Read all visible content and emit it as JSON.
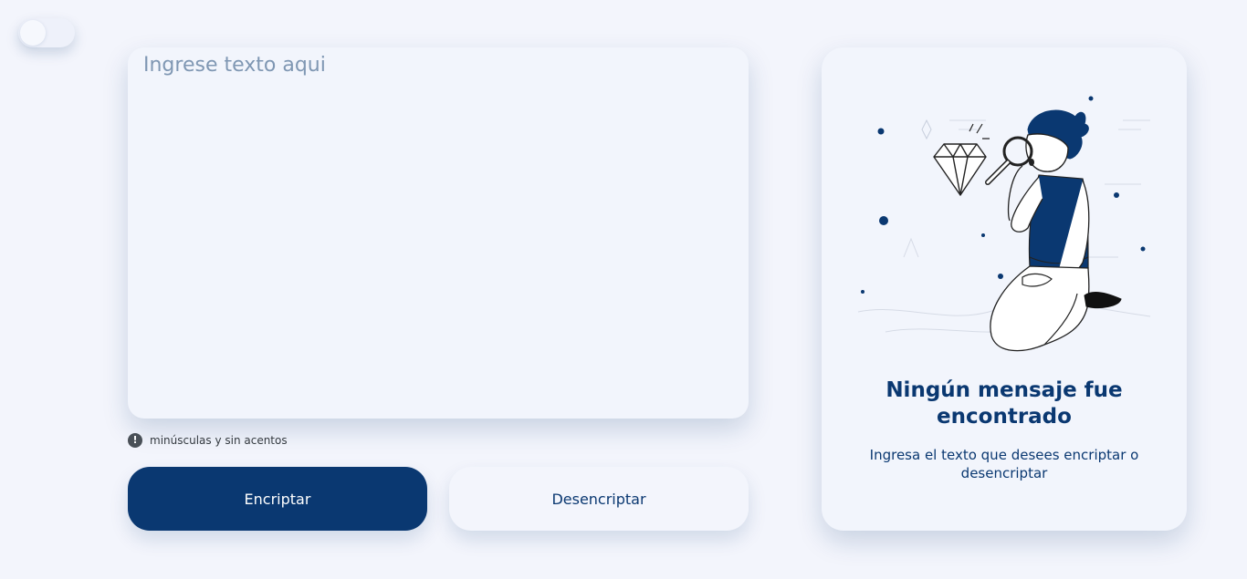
{
  "theme_toggle": {
    "state": "off"
  },
  "input": {
    "placeholder": "Ingrese texto aqui",
    "value": ""
  },
  "hint": {
    "icon": "exclamation-circle-icon",
    "text": "minúsculas y sin acentos"
  },
  "buttons": {
    "encrypt_label": "Encriptar",
    "decrypt_label": "Desencriptar"
  },
  "result": {
    "illustration": "person-with-magnifying-glass-and-diamond",
    "title": "Ningún mensaje fue encontrado",
    "subtitle": "Ingresa el texto que desees encriptar o desencriptar"
  },
  "colors": {
    "primary": "#0a3871",
    "background": "#f3f5fc",
    "card": "#f2f5fc"
  }
}
